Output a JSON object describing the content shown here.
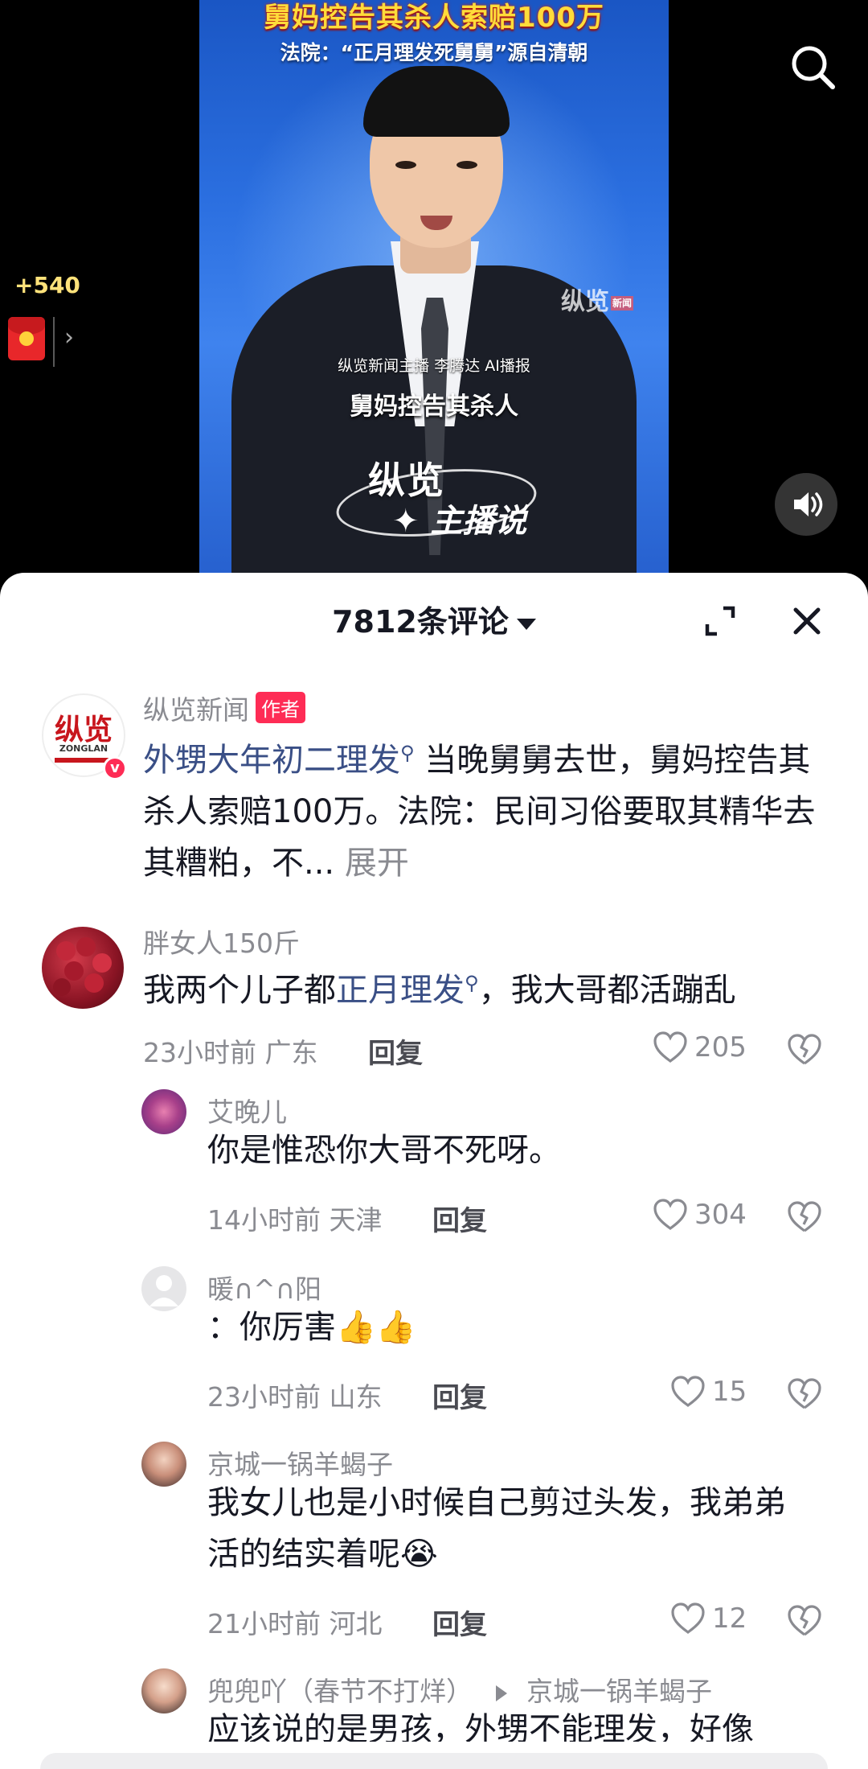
{
  "video": {
    "headline_main": "舅妈控告其杀人索赔100万",
    "headline_sub": "法院：“正月理发死舅舅”源自清朝",
    "watermark": "纵览",
    "watermark_sub": "新闻",
    "caption_small": "纵览新闻主播 李腾达 AI播报",
    "caption_big": "舅妈控告其杀人",
    "brand_line1": "纵览",
    "brand_line2": "✦ 主播说",
    "reward_count": "+540",
    "packet_chevron": "›"
  },
  "panel": {
    "title": "7812条评论"
  },
  "comments": [
    {
      "user": "纵览新闻",
      "badge": "作者",
      "avatar_text": "纵览",
      "avatar_sub": "ZONGLAN",
      "topic": "外甥大年初二理发",
      "text": "当晚舅舅去世，舅妈控告其杀人索赔100万。法院：民间习俗要取其精华去其糟粕，不...",
      "expand": "展开"
    },
    {
      "user": "胖女人150斤",
      "text_before": "我两个儿子都",
      "topic": "正月理发",
      "text_after": "，我大哥都活蹦乱",
      "time": "23小时前 广东",
      "reply": "回复",
      "likes": "205"
    },
    {
      "user": "艾晚儿",
      "text": "你是惟恐你大哥不死呀。",
      "time": "14小时前 天津",
      "reply": "回复",
      "likes": "304"
    },
    {
      "user": "暖∩^∩阳",
      "text": "：你厉害👍👍",
      "time": "23小时前 山东",
      "reply": "回复",
      "likes": "15"
    },
    {
      "user": "京城一锅羊蝎子",
      "text": "我女儿也是小时候自己剪过头发，我弟弟活的结实着呢😭",
      "time": "21小时前 河北",
      "reply": "回复",
      "likes": "12"
    },
    {
      "user": "兜兜吖（春节不打烊）",
      "reply_to": "京城一锅羊蝎子",
      "text": "应该说的是男孩，外甥不能理发，好像"
    }
  ],
  "colors": {
    "accent_red": "#fe2c55",
    "topic_blue": "#3a4f86",
    "meta_gray": "#8a8b91",
    "text_dark": "#161823"
  },
  "icons": [
    "search-icon",
    "red-packet-icon",
    "speaker-icon",
    "expand-icon",
    "close-icon",
    "heart-icon",
    "broken-heart-icon",
    "reply-arrow-icon"
  ]
}
